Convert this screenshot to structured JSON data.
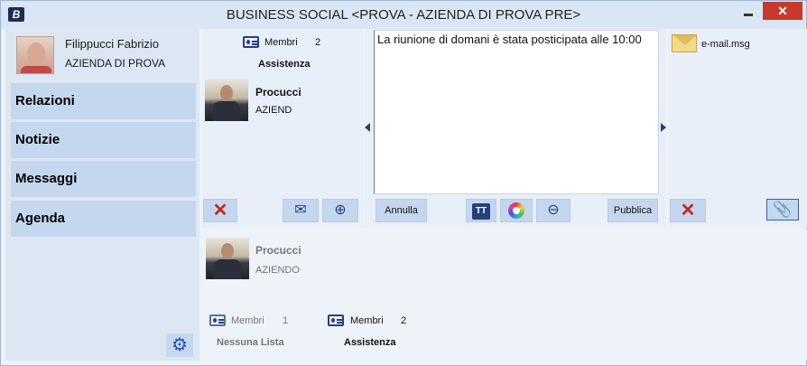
{
  "window": {
    "title": "BUSINESS SOCIAL <PROVA - AZIENDA DI PROVA PRE>",
    "app_icon_letter": "B",
    "close_symbol": "✕"
  },
  "user": {
    "name": "Filippucci Fabrizio",
    "company": "AZIENDA DI PROVA"
  },
  "sidebar": {
    "items": [
      {
        "label": "Relazioni"
      },
      {
        "label": "Notizie"
      },
      {
        "label": "Messaggi"
      },
      {
        "label": "Agenda"
      }
    ],
    "settings_icon": "⚙"
  },
  "members_panel": {
    "members_label": "Membri",
    "members_count": "2",
    "group_title": "Assistenza",
    "person": {
      "name": "Procucci",
      "company": "AZIEND"
    }
  },
  "message": {
    "text": "La riunione di domani è stata posticipata alle 10:00",
    "cancel_label": "Annulla",
    "publish_label": "Pubblica",
    "tt_label": "TT"
  },
  "attachment": {
    "file_name": "e-mail.msg"
  },
  "lower": {
    "person": {
      "name": "Procucci",
      "company": "AZIENDO"
    },
    "list1": {
      "members_label": "Membri",
      "members_count": "1",
      "title": "Nessuna Lista"
    },
    "list2": {
      "members_label": "Membri",
      "members_count": "2",
      "title": "Assistenza"
    }
  },
  "colors": {
    "accent": "#27407a",
    "button_bg": "#c5d7ef",
    "remove_red": "#c0281e",
    "close_red": "#c7392b"
  }
}
